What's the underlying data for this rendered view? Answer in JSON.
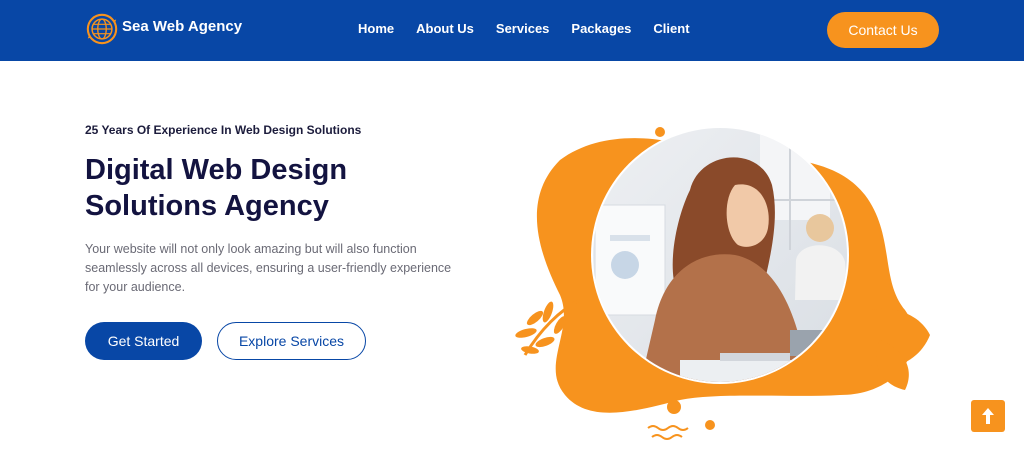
{
  "brand": {
    "name": "Sea Web Agency",
    "logo_icon": "globe-icon"
  },
  "nav": {
    "items": [
      "Home",
      "About Us",
      "Services",
      "Packages",
      "Client"
    ],
    "contact_label": "Contact Us"
  },
  "hero": {
    "eyebrow": "25 Years Of Experience In Web Design Solutions",
    "title": "Digital Web Design Solutions Agency",
    "description": "Your website will not only look amazing but will also function seamlessly across all devices, ensuring a user-friendly experience for your audience.",
    "primary_label": "Get Started",
    "secondary_label": "Explore Services"
  },
  "scroll_top": {
    "icon": "arrow-up-icon"
  },
  "colors": {
    "primary": "#0847a6",
    "accent": "#f7931e",
    "heading": "#131340",
    "body": "#6a6a75"
  }
}
